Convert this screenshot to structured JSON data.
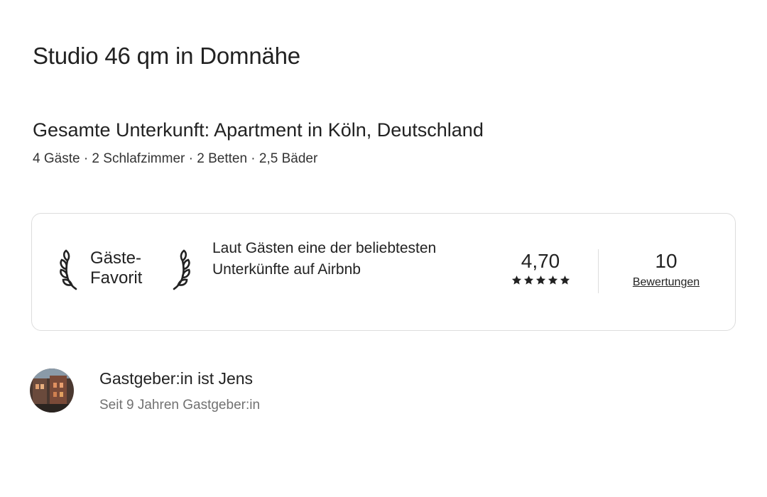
{
  "listing": {
    "title": "Studio 46 qm in Domnähe",
    "subtitle": "Gesamte Unterkunft: Apartment in Köln, Deutschland",
    "details": "4 Gäste · 2 Schlafzimmer · 2 Betten · 2,5 Bäder"
  },
  "guest_favorite": {
    "badge_line1": "Gäste-",
    "badge_line2": "Favorit",
    "description": "Laut Gästen eine der beliebtesten Unterkünfte auf Airbnb",
    "rating": "4,70",
    "stars": 5,
    "review_count": "10",
    "reviews_label": "Bewertungen",
    "icons": [
      "laurel-left-icon",
      "laurel-right-icon",
      "star-icon"
    ]
  },
  "host": {
    "name_line": "Gastgeber:in ist Jens",
    "since": "Seit 9 Jahren Gastgeber:in"
  },
  "colors": {
    "text_primary": "#222222",
    "text_secondary": "#717171",
    "border": "#dddddd"
  }
}
